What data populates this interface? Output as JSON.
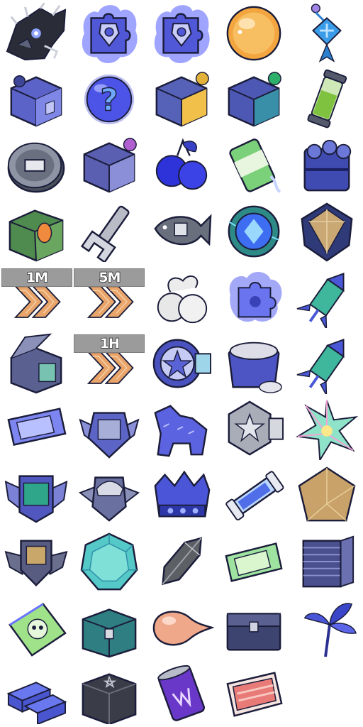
{
  "sheet": {
    "columns": 5,
    "rows": 11,
    "speedup_tags": {
      "tag_1m": "1M",
      "tag_5m": "5M",
      "tag_1h": "1H"
    },
    "palette": {
      "item_blue": "#5b62e0",
      "dark_outline": "#1b1d3a",
      "speedup_orange": "#e8a46a",
      "orb_orange": "#f3a640",
      "mint_green": "#6fd7a3",
      "tag_gray": "#9b9b9b"
    }
  },
  "items": [
    {
      "icon": "dark-mech-dragon-icon"
    },
    {
      "icon": "blue-flame-puzzle-badge-icon"
    },
    {
      "icon": "blue-flame-puzzle-badge-icon"
    },
    {
      "icon": "orange-orb-icon"
    },
    {
      "icon": "chinese-knot-charm-icon"
    },
    {
      "icon": "blueprint-box-icon"
    },
    {
      "icon": "mystery-question-orb-icon"
    },
    {
      "icon": "gold-blueprint-box-icon"
    },
    {
      "icon": "green-blueprint-box-icon"
    },
    {
      "icon": "green-serum-tube-icon"
    },
    {
      "icon": "silver-coin-icon"
    },
    {
      "icon": "purple-blueprint-box-icon"
    },
    {
      "icon": "blue-berry-cluster-icon"
    },
    {
      "icon": "green-soda-can-icon"
    },
    {
      "icon": "log-bundle-icon"
    },
    {
      "icon": "green-supply-crate-icon"
    },
    {
      "icon": "wrench-icon"
    },
    {
      "icon": "metal-fish-icon"
    },
    {
      "icon": "crystal-core-icon"
    },
    {
      "icon": "shield-crystal-icon"
    },
    {
      "icon": "speedup-1m-icon"
    },
    {
      "icon": "speedup-5m-icon"
    },
    {
      "icon": "white-fruit-icon"
    },
    {
      "icon": "blue-flame-puzzle-piece-icon"
    },
    {
      "icon": "firework-rocket-icon"
    },
    {
      "icon": "open-tech-crate-icon"
    },
    {
      "icon": "speedup-1h-icon"
    },
    {
      "icon": "star-gear-badge-icon"
    },
    {
      "icon": "flour-sack-icon"
    },
    {
      "icon": "firework-rocket-icon"
    },
    {
      "icon": "blue-ticket-icon"
    },
    {
      "icon": "winged-frame-badge-icon"
    },
    {
      "icon": "blue-tiger-figurine-icon"
    },
    {
      "icon": "silver-star-emblem-icon"
    },
    {
      "icon": "rainbow-star-crystal-icon"
    },
    {
      "icon": "winged-screen-badge-icon"
    },
    {
      "icon": "winged-cap-badge-icon"
    },
    {
      "icon": "royal-crown-icon"
    },
    {
      "icon": "energy-capsule-icon"
    },
    {
      "icon": "gold-pyramid-crystal-icon"
    },
    {
      "icon": "winged-shield-badge-icon"
    },
    {
      "icon": "cyan-gem-icon"
    },
    {
      "icon": "smoky-crystal-shard-icon"
    },
    {
      "icon": "green-ticket-icon"
    },
    {
      "icon": "stacked-plates-icon"
    },
    {
      "icon": "skull-card-icon"
    },
    {
      "icon": "teal-treasure-chest-icon"
    },
    {
      "icon": "peach-droplet-icon"
    },
    {
      "icon": "navy-chest-icon"
    },
    {
      "icon": "blue-herb-bundle-icon"
    },
    {
      "icon": "blue-ingot-bars-icon"
    },
    {
      "icon": "dark-pentagram-chest-icon"
    },
    {
      "icon": "purple-can-icon"
    },
    {
      "icon": "red-bacon-pack-icon"
    },
    {
      "icon": ""
    }
  ]
}
